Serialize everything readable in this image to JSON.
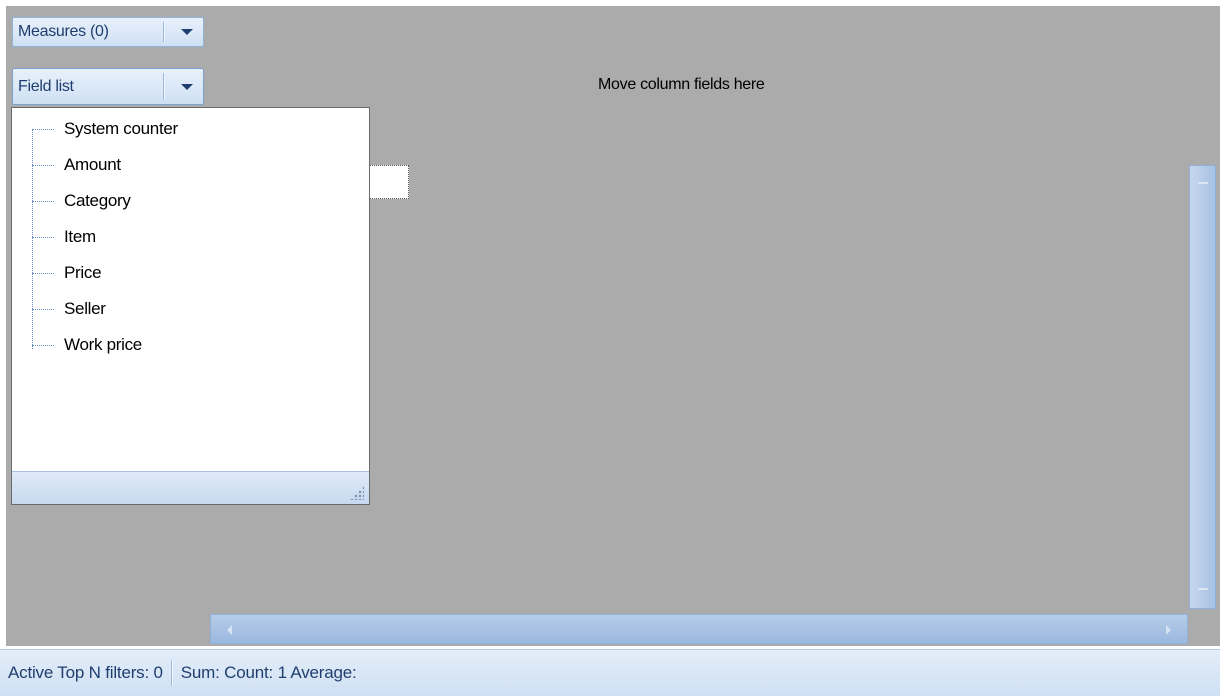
{
  "toolbar": {
    "measures_label": "Measures (0)",
    "fieldlist_label": "Field list"
  },
  "column_drop_zone": "Move column fields here",
  "field_list": {
    "items": [
      {
        "label": "System counter"
      },
      {
        "label": "Amount"
      },
      {
        "label": "Category"
      },
      {
        "label": "Item"
      },
      {
        "label": "Price"
      },
      {
        "label": "Seller"
      },
      {
        "label": "Work price"
      }
    ]
  },
  "status_bar": {
    "filters": "Active Top N filters: 0",
    "summary": "Sum:  Count: 1 Average:"
  },
  "colors": {
    "grid_background": "#ababab",
    "accent": "#1f3e6e",
    "scrollbar": "#a8c2e3"
  },
  "icons": [
    "chevron-down-icon",
    "tree-connector-icon",
    "resize-grip-icon",
    "scroll-arrow-icon"
  ]
}
